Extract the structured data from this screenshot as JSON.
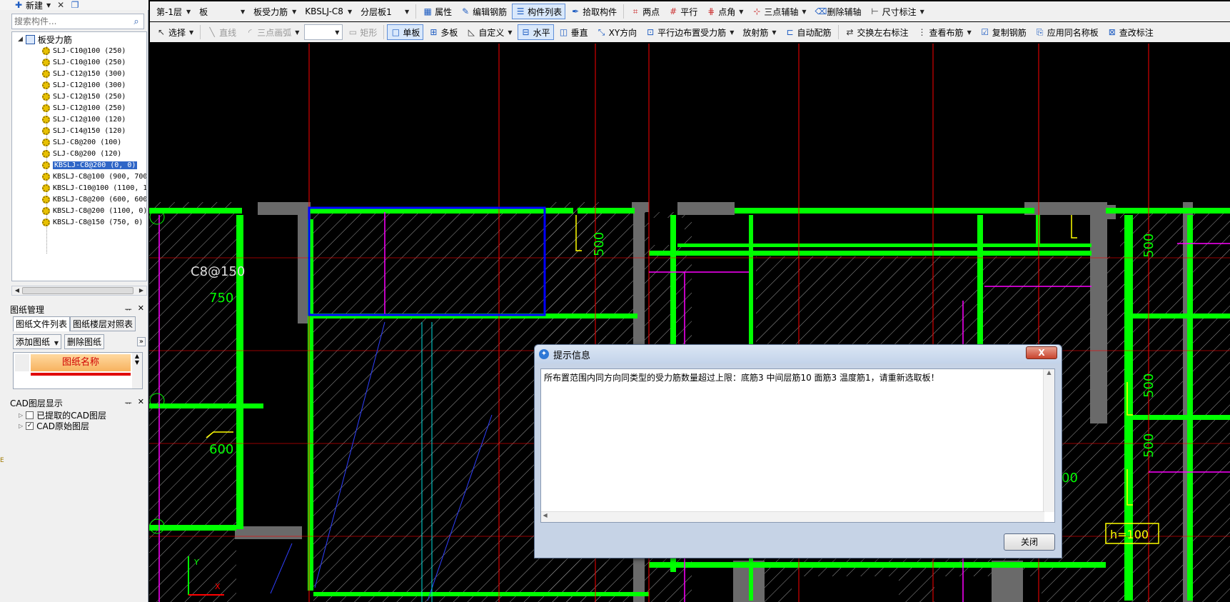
{
  "left_panel": {
    "new_label": "新建",
    "search_placeholder": "搜索构件...",
    "tree_root": "板受力筋",
    "tree_items": [
      "SLJ-C10@100 (250)",
      "SLJ-C10@100 (250)",
      "SLJ-C12@150 (300)",
      "SLJ-C12@100 (300)",
      "SLJ-C12@150 (250)",
      "SLJ-C12@100 (250)",
      "SLJ-C12@100 (120)",
      "SLJ-C14@150 (120)",
      "SLJ-C8@200 (100)",
      "SLJ-C8@200 (120)",
      "KBSLJ-C8@200 (0, 0)",
      "KBSLJ-C8@100 (900, 700)",
      "KBSLJ-C10@100 (1100, 11",
      "KBSLJ-C8@200 (600, 600)",
      "KBSLJ-C8@200 (1100, 0)",
      "KBSLJ-C8@150 (750, 0)"
    ],
    "selected_index": 10,
    "drawing_panel": {
      "title": "图纸管理",
      "tabs": [
        "图纸文件列表",
        "图纸楼层对照表"
      ],
      "add_button": "添加图纸",
      "delete_button": "删除图纸",
      "column_header": "图纸名称"
    },
    "cad_panel": {
      "title": "CAD图层显示",
      "layers": [
        {
          "label": "已提取的CAD图层",
          "checked": false
        },
        {
          "label": "CAD原始图层",
          "checked": true
        }
      ]
    }
  },
  "toolbar1": {
    "floor": "第-1层",
    "category": "板",
    "component_type": "板受力筋",
    "component": "KBSLJ-C8",
    "layer": "分层板1",
    "buttons": [
      "属性",
      "编辑钢筋",
      "构件列表",
      "拾取构件",
      "两点",
      "平行",
      "点角",
      "三点辅轴",
      "删除辅轴",
      "尺寸标注"
    ],
    "active_button": "构件列表"
  },
  "toolbar2": {
    "buttons": [
      "选择",
      "直线",
      "三点画弧",
      "矩形",
      "单板",
      "多板",
      "自定义",
      "水平",
      "垂直",
      "XY方向",
      "平行边布置受力筋",
      "放射筋",
      "自动配筋",
      "交换左右标注",
      "查看布筋",
      "复制钢筋",
      "应用同名称板",
      "查改标注"
    ],
    "active_buttons": [
      "单板",
      "水平"
    ],
    "disabled_buttons": [
      "直线",
      "三点画弧",
      "矩形"
    ]
  },
  "canvas": {
    "labels": [
      "C8@150",
      "750",
      "600",
      "500",
      "500",
      "500",
      "500",
      "h=100",
      "00"
    ]
  },
  "dialog": {
    "title": "提示信息",
    "message": "所布置范围内同方向同类型的受力筋数量超过上限：底筋3 中间层筋10 面筋3 温度筋1，请重新选取板！",
    "close_button": "关闭",
    "close_x": "X"
  },
  "colors": {
    "canvas_bg": "#000000",
    "wall_green": "#00ff00",
    "selection_blue": "#0000ff",
    "grid_red": "#ff0000",
    "rebar_magenta": "#ff00ff",
    "dimension_yellow": "#ffff00"
  }
}
